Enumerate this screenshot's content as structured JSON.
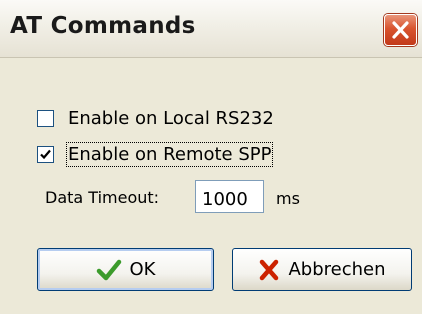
{
  "window": {
    "title": "AT Commands",
    "close_icon": "close-icon"
  },
  "options": [
    {
      "label": "Enable on Local RS232",
      "checked": false
    },
    {
      "label": "Enable on Remote SPP",
      "checked": true
    }
  ],
  "timeout": {
    "label": "Data Timeout:",
    "value": "1000",
    "unit": "ms"
  },
  "buttons": {
    "ok_label": "OK",
    "ok_icon": "checkmark-icon",
    "cancel_label": "Abbrechen",
    "cancel_icon": "x-icon"
  },
  "colors": {
    "dialog_bg": "#ece9d8",
    "close_button": "#d9542f",
    "ok_check": "#3c9b2c",
    "cancel_x": "#cc2200"
  }
}
